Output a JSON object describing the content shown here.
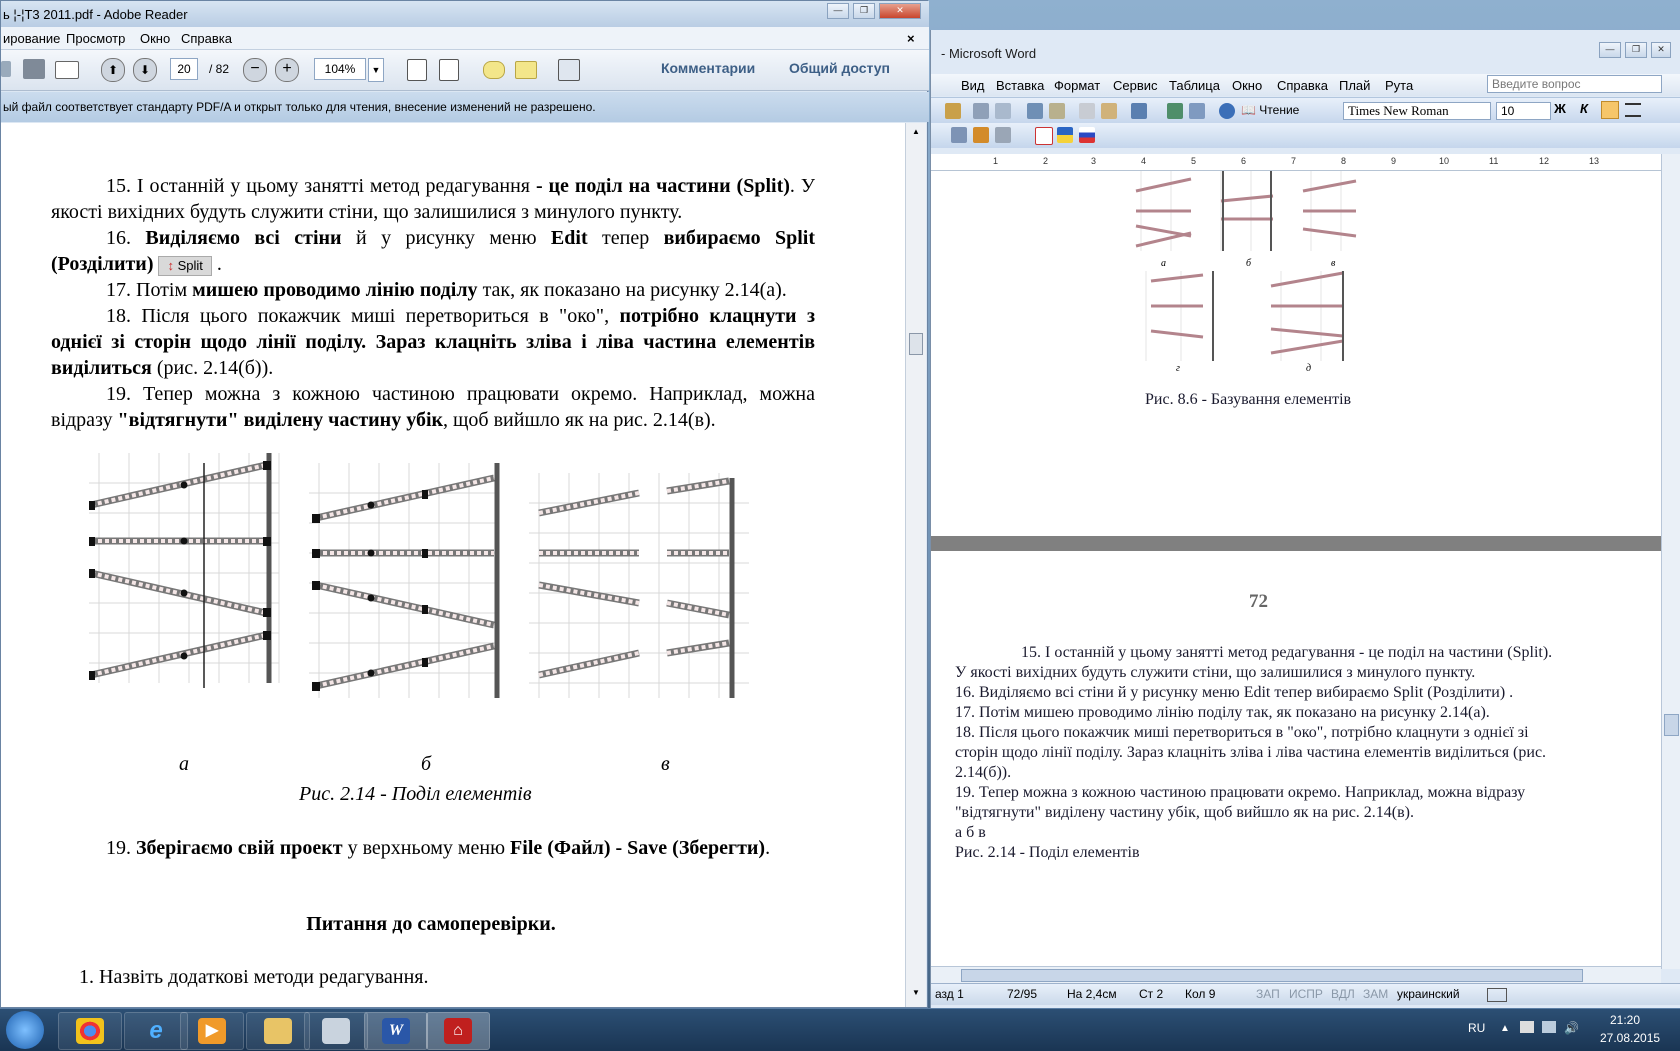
{
  "word": {
    "title": "- Microsoft Word",
    "menu": [
      "Вид",
      "Вставка",
      "Формат",
      "Сервис",
      "Таблица",
      "Окно",
      "Справка",
      "Плай",
      "Рута"
    ],
    "ask_placeholder": "Введите вопрос",
    "reading_label": "Чтение",
    "font": "Times New Roman",
    "size": "10",
    "bold": "Ж",
    "italic": "К",
    "ruler": [
      "1",
      "2",
      "3",
      "4",
      "5",
      "6",
      "7",
      "8",
      "9",
      "10",
      "11",
      "12",
      "13"
    ],
    "page1_caption": "Рис. 8.6 - Базування елементів",
    "page1_letters": [
      "а",
      "б",
      "в",
      "г",
      "д"
    ],
    "page_number": "72",
    "body": [
      "15. І останній у цьому занятті метод редагування - це поділ на частини (Split). У якості вихідних будуть служити стіни, що залишилися з минулого пункту.",
      "16. Виділяємо всі стіни й у рисунку меню Edit тепер вибираємо Split (Розділити) .",
      "17. Потім мишею проводимо лінію поділу так, як показано на рисунку 2.14(а).",
      "18. Після цього покажчик миші перетвориться в \"око\", потрібно клацнути з однієї зі сторін щодо лінії поділу. Зараз клацніть зліва і ліва частина елементів виділиться (рис. 2.14(б)).",
      "19. Тепер можна з кожною частиною працювати окремо. Наприклад, можна відразу \"відтягнути\" виділену частину убік, щоб вийшло як на рис. 2.14(в).",
      "а б в",
      "Рис. 2.14 - Поділ елементів"
    ],
    "status": {
      "section": "азд 1",
      "pages": "72/95",
      "at": "На 2,4см",
      "line": "Ст 2",
      "col": "Кол 9",
      "rec": "ЗАП",
      "trk": "ИСПР",
      "ext": "ВДЛ",
      "ovr": "ЗАМ",
      "lang": "украинский"
    }
  },
  "adobe": {
    "title": "ь ¦-¦Т3 2011.pdf - Adobe Reader",
    "menu": [
      "ирование",
      "Просмотр",
      "Окно",
      "Справка"
    ],
    "page_current": "20",
    "page_total": "/ 82",
    "zoom": "104%",
    "comments_label": "Комментарии",
    "share_label": "Общий доступ",
    "notice": "ый файл соответствует стандарту PDF/A и открыт только для чтения, внесение изменений не разрешено.",
    "split_button": "Split",
    "p15a": "15. І останній у цьому занятті метод редагування ",
    "p15b": "- це ",
    "p15c": "поділ на частини (Split)",
    "p15d": ". У якості вихідних будуть служити стіни, що залишилися з минулого пункту.",
    "p16a": "16. ",
    "p16b": "Виділяємо всі стіни",
    "p16c": " й у рисунку меню ",
    "p16d": "Edit",
    "p16e": " тепер ",
    "p16f": "вибираємо Split (Розділити)",
    "p16g": " .",
    "p17a": "17. Потім ",
    "p17b": "мишею проводимо лінію поділу",
    "p17c": " так, як показано на рисунку 2.14(а).",
    "p18a": "18. Після цього покажчик миші перетвориться в \"око\", ",
    "p18b": "потрібно клацнути з однієї зі сторін щодо лінії поділу. Зараз клацніть зліва і ліва частина елементів виділиться",
    "p18c": " (рис. 2.14(б)).",
    "p19a": "19. Тепер можна з кожною частиною працювати окремо. Наприклад, можна відразу ",
    "p19b": "\"відтягнути\" виділену частину убік",
    "p19c": ", щоб вийшло як на рис. 2.14(в).",
    "fig_letters": [
      "а",
      "б",
      "в"
    ],
    "fig_caption": "Рис. 2.14 - Поділ елементів",
    "p19s_a": "19. ",
    "p19s_b": "Зберігаємо свій проект",
    "p19s_c": " у верхньому меню ",
    "p19s_d": "File (Файл) - Save (Зберегти)",
    "p19s_e": ".",
    "questions_title": "Питання до самоперевірки.",
    "q1": "1.  Назвіть додаткові методи редагування."
  },
  "taskbar": {
    "lang": "RU",
    "time": "21:20",
    "date": "27.08.2015"
  }
}
